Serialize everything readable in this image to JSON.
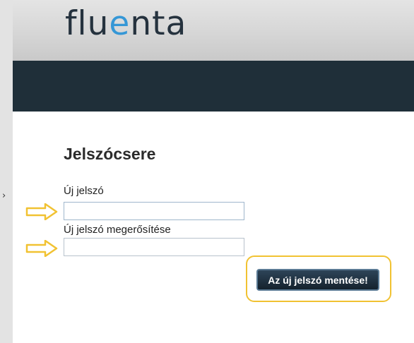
{
  "gutter": {
    "arrow_glyph": "›"
  },
  "header": {
    "logo_before": "flu",
    "logo_accent": "e",
    "logo_after": "nta",
    "accent_color": "#3597d6",
    "bar_color": "#1f2f39"
  },
  "form": {
    "title": "Jelszócsere",
    "new_password_label": "Új jelszó",
    "new_password_value": "",
    "confirm_password_label": "Új jelszó megerősítése",
    "confirm_password_value": "",
    "save_label": "Az új jelszó mentése!"
  },
  "annotations": {
    "arrow_color": "#f1c232",
    "highlight_color": "#f1c232"
  }
}
